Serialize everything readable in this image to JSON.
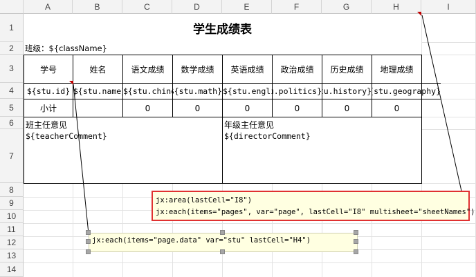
{
  "columns": [
    "A",
    "B",
    "C",
    "D",
    "E",
    "F",
    "G",
    "H",
    "I"
  ],
  "rows": [
    "1",
    "2",
    "3",
    "4",
    "5",
    "6",
    "7",
    "8",
    "9",
    "10",
    "11",
    "12",
    "13",
    "14"
  ],
  "title": "学生成绩表",
  "class_line": "班级：${className}",
  "headers": [
    "学号",
    "姓名",
    "语文成绩",
    "数学成绩",
    "英语成绩",
    "政治成绩",
    "历史成绩",
    "地理成绩"
  ],
  "data_row": [
    "${stu.id}",
    "${stu.name}",
    "${stu.chinese}",
    "${stu.math}",
    "${stu.english}",
    "${stu.politics}",
    "${stu.history}",
    "${stu.geography}"
  ],
  "subtotal": {
    "label": "小计",
    "values": [
      "0",
      "0",
      "0",
      "0",
      "0",
      "0"
    ]
  },
  "teacher": {
    "label": "班主任意见",
    "value": "${teacherComment}"
  },
  "director": {
    "label": "年级主任意见",
    "value": "${directorComment}"
  },
  "comment_area": {
    "line1": "jx:area(lastCell=\"I8\")",
    "line2": "jx:each(items=\"pages\", var=\"page\", lastCell=\"I8\" multisheet=\"sheetNames\")"
  },
  "comment_each": {
    "line1": "jx:each(items=\"page.data\" var=\"stu\" lastCell=\"H4\")"
  }
}
